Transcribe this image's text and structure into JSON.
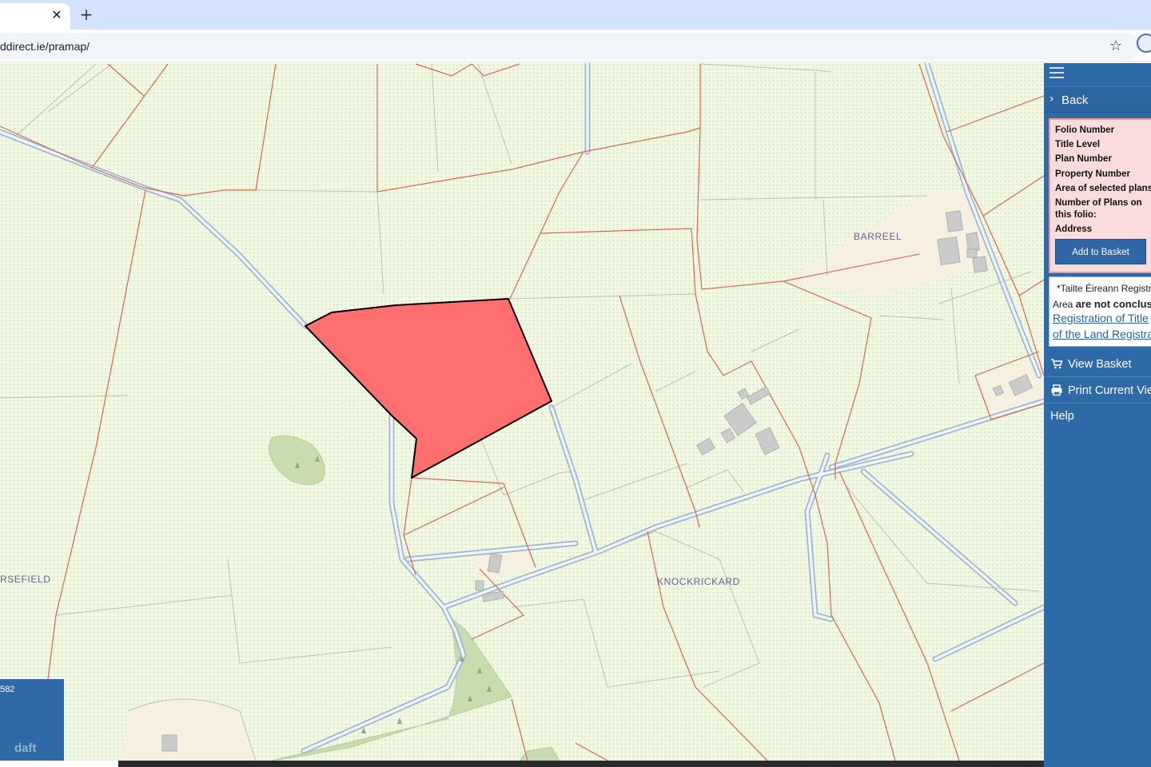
{
  "browser": {
    "tab_close_glyph": "✕",
    "new_tab_glyph": "+",
    "url": "ddirect.ie/pramap/",
    "bookmark_icon": "☆"
  },
  "map": {
    "labels": {
      "barreel": "BARREEL",
      "knockrickard": "KNOCKRICKARD",
      "horsefield": "RSEFIELD"
    },
    "scale_text": "582",
    "watermark": "daft",
    "colors": {
      "background": "#f1f8e2",
      "boundary": "#d76a4f",
      "selected_fill": "#ff6f6f",
      "road": "#9cb7d0",
      "building": "#cbcbcb"
    }
  },
  "sidebar": {
    "back_label": "Back",
    "info_fields": [
      "Folio Number",
      "Title Level",
      "Plan Number",
      "Property Number",
      "Area of selected plans",
      "Number of Plans on",
      "this folio:",
      "Address"
    ],
    "add_to_basket": "Add to Basket",
    "disclaimer": {
      "line1": "*Tailte Éireann Registra",
      "line2_prefix": "Area ",
      "line2_bold": "are not conclusiv",
      "link1": "Registration of Title",
      "link2": "of the Land Registra"
    },
    "view_basket": "View Basket",
    "print_view": "Print Current Vie",
    "help": "Help"
  }
}
